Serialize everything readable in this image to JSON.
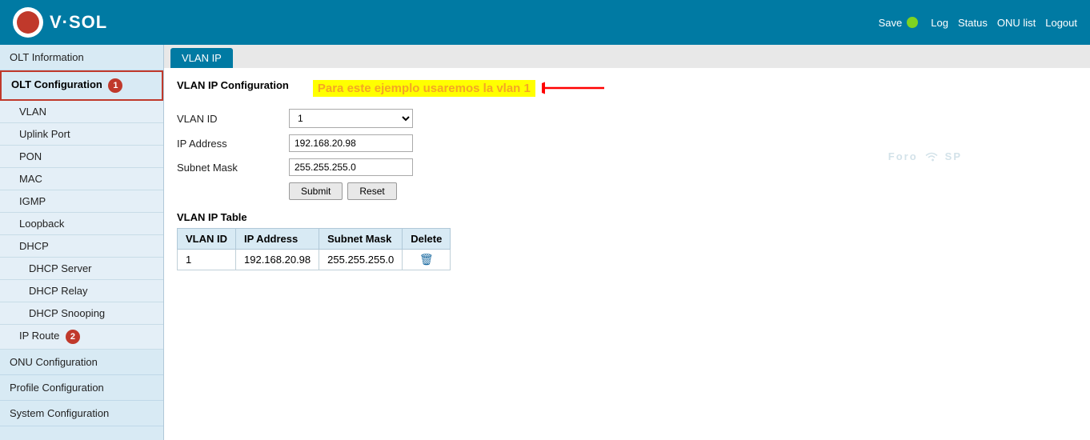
{
  "header": {
    "logo_text": "V·SOL",
    "save_label": "Save",
    "status_dot_color": "#7ed321",
    "nav_links": [
      "Log",
      "Status",
      "ONU list",
      "Logout"
    ]
  },
  "sidebar": {
    "items": [
      {
        "id": "olt-information",
        "label": "OLT Information",
        "type": "top",
        "active": false
      },
      {
        "id": "olt-configuration",
        "label": "OLT Configuration",
        "type": "top",
        "active": true,
        "badge": "1"
      },
      {
        "id": "vlan",
        "label": "VLAN",
        "type": "sub"
      },
      {
        "id": "uplink-port",
        "label": "Uplink Port",
        "type": "sub"
      },
      {
        "id": "pon",
        "label": "PON",
        "type": "sub"
      },
      {
        "id": "mac",
        "label": "MAC",
        "type": "sub"
      },
      {
        "id": "igmp",
        "label": "IGMP",
        "type": "sub"
      },
      {
        "id": "loopback",
        "label": "Loopback",
        "type": "sub"
      },
      {
        "id": "dhcp",
        "label": "DHCP",
        "type": "sub"
      },
      {
        "id": "dhcp-server",
        "label": "DHCP Server",
        "type": "subsub"
      },
      {
        "id": "dhcp-relay",
        "label": "DHCP Relay",
        "type": "subsub"
      },
      {
        "id": "dhcp-snooping",
        "label": "DHCP Snooping",
        "type": "subsub"
      },
      {
        "id": "ip-route",
        "label": "IP Route",
        "type": "sub",
        "active": true,
        "badge": "2"
      },
      {
        "id": "onu-configuration",
        "label": "ONU Configuration",
        "type": "top"
      },
      {
        "id": "profile-configuration",
        "label": "Profile Configuration",
        "type": "top"
      },
      {
        "id": "system-configuration",
        "label": "System Configuration",
        "type": "top"
      }
    ]
  },
  "tab": {
    "label": "VLAN IP"
  },
  "content": {
    "section_title": "VLAN IP Configuration",
    "annotation": "Para este ejemplo usaremos la vlan 1",
    "form": {
      "vlan_id_label": "VLAN ID",
      "vlan_id_value": "1",
      "ip_address_label": "IP Address",
      "ip_address_value": "192.168.20.98",
      "subnet_mask_label": "Subnet Mask",
      "subnet_mask_value": "255.255.255.0",
      "submit_label": "Submit",
      "reset_label": "Reset"
    },
    "table": {
      "title": "VLAN IP Table",
      "headers": [
        "VLAN ID",
        "IP Address",
        "Subnet Mask",
        "Delete"
      ],
      "rows": [
        {
          "vlan_id": "1",
          "ip_address": "192.168.20.98",
          "subnet_mask": "255.255.255.0"
        }
      ]
    }
  },
  "watermark": "ForoISP"
}
